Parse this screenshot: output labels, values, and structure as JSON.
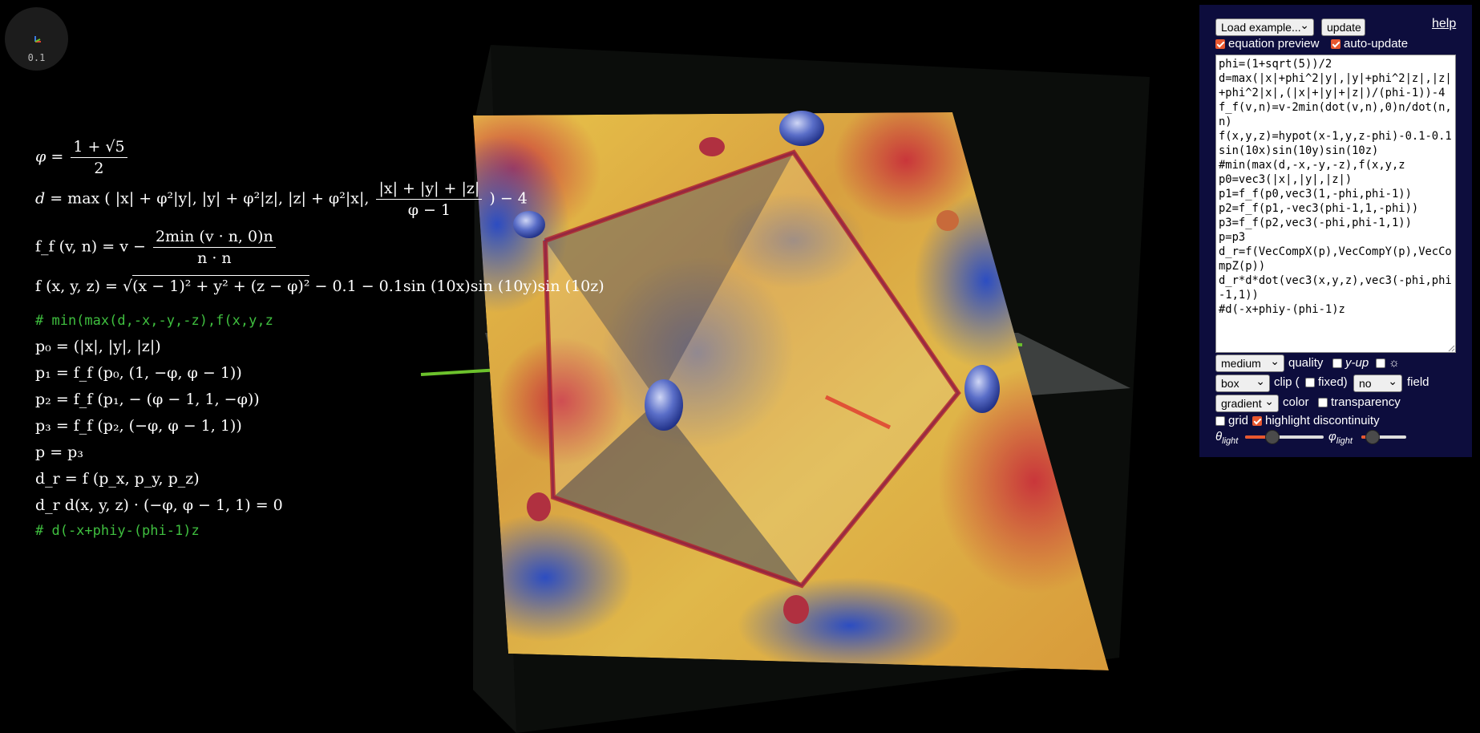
{
  "axis_widget": {
    "scale": "0.1"
  },
  "equations": {
    "phi_def": {
      "lhs": "φ",
      "num": "1 + √5",
      "den": "2"
    },
    "d_def": {
      "lhs": "d",
      "body": "max ( |x| + φ²|y|, |y| + φ²|z|, |z| + φ²|x|,",
      "frac_num": "|x| + |y| + |z|",
      "frac_den": "φ − 1",
      "tail": ") − 4"
    },
    "ff_def": {
      "lhs": "f_f (v, n) = v −",
      "num": "2min (v · n, 0)n",
      "den": "n · n"
    },
    "f_def": {
      "lhs": "f (x, y, z) =",
      "radicand": "(x − 1)² + y² + (z − φ)²",
      "tail": " − 0.1 − 0.1sin (10x)sin (10y)sin (10z)"
    },
    "comment1": "# min(max(d,-x,-y,-z),f(x,y,z",
    "p0": "p₀ = (|x|, |y|, |z|)",
    "p1": "p₁ = f_f (p₀, (1, −φ, φ − 1))",
    "p2": "p₂ = f_f (p₁, − (φ − 1, 1, −φ))",
    "p3": "p₃ = f_f (p₂, (−φ, φ − 1, 1))",
    "p": "p = p₃",
    "dr": "d_r = f (p_x, p_y, p_z)",
    "final": "d_r d(x, y, z) · (−φ, φ − 1, 1) = 0",
    "comment2": "# d(-x+phiy-(phi-1)z"
  },
  "panel": {
    "example_select": "Load example...",
    "update_button": "update",
    "help_link": "help",
    "equation_preview": {
      "label": "equation preview",
      "checked": true
    },
    "auto_update": {
      "label": "auto-update",
      "checked": true
    },
    "code": "phi=(1+sqrt(5))/2\nd=max(|x|+phi^2|y|,|y|+phi^2|z|,|z|+phi^2|x|,(|x|+|y|+|z|)/(phi-1))-4\nf_f(v,n)=v-2min(dot(v,n),0)n/dot(n,n)\nf(x,y,z)=hypot(x-1,y,z-phi)-0.1-0.1sin(10x)sin(10y)sin(10z)\n#min(max(d,-x,-y,-z),f(x,y,z\np0=vec3(|x|,|y|,|z|)\np1=f_f(p0,vec3(1,-phi,phi-1))\np2=f_f(p1,-vec3(phi-1,1,-phi))\np3=f_f(p2,vec3(-phi,phi-1,1))\np=p3\nd_r=f(VecCompX(p),VecCompY(p),VecCompZ(p))\nd_r*d*dot(vec3(x,y,z),vec3(-phi,phi-1,1))\n#d(-x+phiy-(phi-1)z",
    "quality_select": "medium",
    "quality_label": "quality",
    "y_up": {
      "label": "y-up",
      "checked": false
    },
    "sun": {
      "label": "☼",
      "checked": false
    },
    "clip_select": "box",
    "clip_label": "clip (",
    "fixed": {
      "label": "fixed)",
      "checked": false
    },
    "field_select": "no",
    "field_label": "field",
    "color_select": "gradient",
    "color_label": "color",
    "transparency": {
      "label": "transparency",
      "checked": false
    },
    "grid": {
      "label": "grid",
      "checked": false
    },
    "highlight": {
      "label": "highlight discontinuity",
      "checked": true
    },
    "theta_label": "θ",
    "theta_sub": "light",
    "phi_label": "φ",
    "phi_sub": "light",
    "theta_value": 0.35,
    "phi_value": 0.25
  },
  "colors": {
    "panel_bg": "#0d0d3d",
    "accent": "#e8572f",
    "comment": "#3fbf3f"
  }
}
